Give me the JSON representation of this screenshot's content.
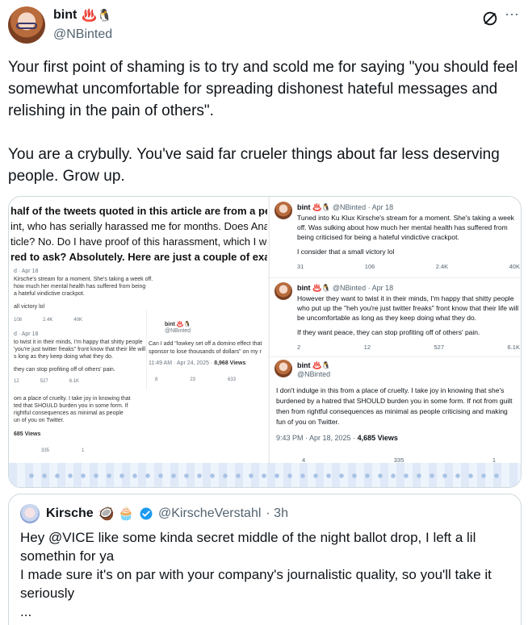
{
  "author": {
    "display_name": "bint",
    "emojis": "♨️🐧",
    "handle": "@NBinted"
  },
  "tweet": {
    "paragraph_1": "Your first point of shaming is to try and scold me for saying \"you should feel somewhat uncomfortable for spreading dishonest hateful messages and relishing in the pain of others\".",
    "paragraph_2": "You are a crybully. You've said far crueler things about far less deserving people. Grow up."
  },
  "media": {
    "article_lines": [
      "half of the tweets quoted in this article are from a person",
      "int, who has serially harassed me for months. Does Ana V",
      "ticle? No. Do I have proof of this harassment, which I woul",
      "red to ask? Absolutely. Here are just a couple of exampl"
    ],
    "left_mini": {
      "head_1": "d · Apr 18",
      "body_1": "Kirsche's stream for a moment. She's taking a week off.",
      "body_1b": "how much her mental health has suffered from being",
      "body_1c": "a hateful vindictive crackpot.",
      "line_victory": "all victory lol",
      "actions_1": [
        "108",
        "2.4K",
        "40K"
      ],
      "head_2": "d · Apr 18",
      "body_2": "to twist it in their minds, I'm happy that shitty people",
      "body_2b": "'you're just twitter freaks\" front know that their life will",
      "body_2c": "s long as they keep doing what they do.",
      "body_2d": "they can stop profiting off of others' pain.",
      "actions_2": [
        "12",
        "527",
        "6.1K"
      ],
      "body_3": "om a place of cruelty. I take joy in knowing that",
      "body_3b": "ted that SHOULD burden you in some form. If",
      "body_3c": "rightful consequences as minimal as people",
      "body_3d": "un of you on Twitter.",
      "views_3": "685 Views",
      "actions_3": [
        "335",
        "1"
      ],
      "emb_name": "bint ♨️🐧",
      "emb_handle": "@NBinted",
      "emb_text_1": "Can I add \"lowkey set off a domino effect that",
      "emb_text_2": "sponsor to lose thousands of dollars\" on my r",
      "emb_time": "11:49 AM · Apr 24, 2025 · ",
      "emb_views": "8,968 Views",
      "emb_actions": [
        "8",
        "23",
        "633"
      ]
    },
    "right": {
      "rt1_name": "bint",
      "rt1_meta": " ♨️🐧 @NBinted · Apr 18",
      "rt1_body": "Tuned into Ku Klux Kirsche's stream for a moment. She's taking a week off. Was sulking about how much her mental health has suffered from being criticised for being a hateful vindictive crackpot.",
      "rt1_body_2": "I consider that a small victory lol",
      "rt1_actions": [
        "31",
        "106",
        "2.4K",
        "40K"
      ],
      "rt2_name": "bint",
      "rt2_meta": " ♨️🐧 @NBinted · Apr 18",
      "rt2_body": "However they want to twist it in their minds, I'm happy that shitty people who put up the \"heh you're just twitter freaks\" front know that their life will be uncomfortable as long as they keep doing what they do.",
      "rt2_body_2": "If they want peace, they can stop profiting off of others' pain.",
      "rt2_actions": [
        "2",
        "12",
        "527",
        "6.1K"
      ],
      "rt3_name": "bint",
      "rt3_meta": " ♨️🐧",
      "rt3_handle": "@NBinted",
      "rt3_body": "I don't indulge in this from a place of cruelty. I take joy in knowing that she's burdened by a hatred that SHOULD burden you in some form. If not from guilt then from rightful consequences as minimal as people criticising and making fun of you on Twitter.",
      "rt3_time": "9:43 PM · Apr 18, 2025 · ",
      "rt3_views": "4,685 Views",
      "rt3_actions": [
        "4",
        "335",
        "1"
      ]
    }
  },
  "quote": {
    "display_name": "Kirsche",
    "emojis": "🥥 🧁",
    "handle": "@KirscheVerstahl",
    "time": "· 3h",
    "line_1": "Hey @VICE like some kinda secret middle of the night ballot drop, I left a lil somethin for ya",
    "line_2": "I made sure it's on par with your company's journalistic quality, so you'll take it seriously",
    "line_3": "..."
  },
  "colors": {
    "text": "#0f1419",
    "secondary": "#536471",
    "border": "#cfd9de",
    "verified": "#1d9bf0"
  }
}
